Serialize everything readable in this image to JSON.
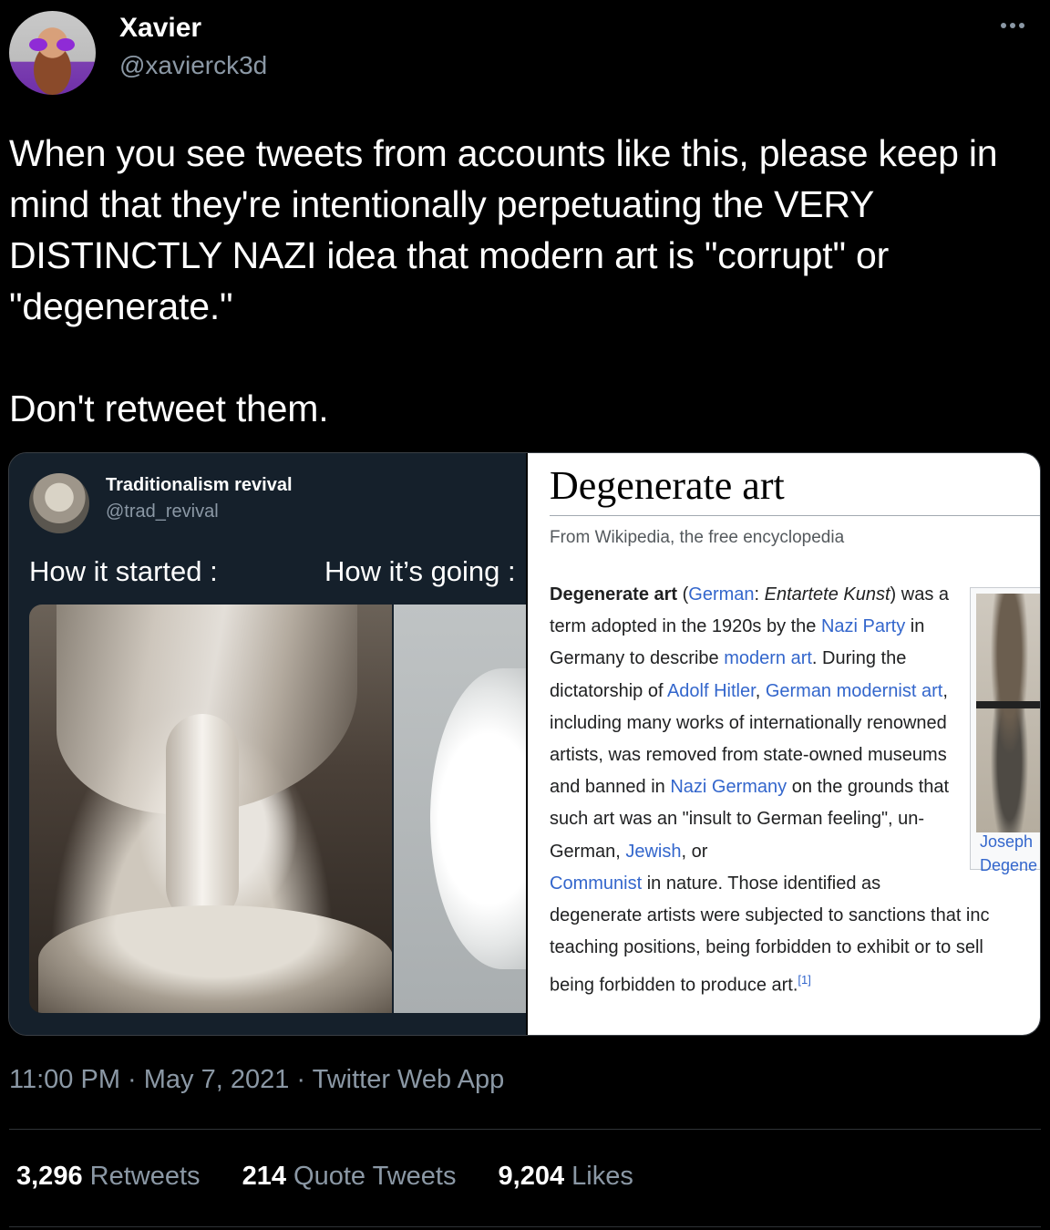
{
  "author": {
    "name": "Xavier",
    "handle": "@xavierck3d"
  },
  "tweet": {
    "text": "When you see tweets from accounts like this, please keep in mind that they're intentionally perpetuating the VERY DISTINCTLY NAZI idea that modern art is \"corrupt\" or \"degenerate.\"\n\nDon't retweet them.",
    "timestamp": "11:00 PM · May 7, 2021 · Twitter Web App"
  },
  "embedded": {
    "name": "Traditionalism revival",
    "handle": "@trad_revival",
    "caption_left": "How it started :",
    "caption_right": "How it’s going :"
  },
  "wiki": {
    "title": "Degenerate art",
    "from": "From Wikipedia, the free encyclopedia",
    "term": "Degenerate art",
    "german_label": "German",
    "german_term": "Entartete Kunst",
    "t1": "was a term adopted in the 1920s by the",
    "link_nazi_party": "Nazi Party",
    "t2": " in Germany to describe ",
    "link_modern_art": "modern art",
    "t3": ". During the dictatorship of ",
    "link_hitler": "Adolf Hitler",
    "link_german_modernist": "German modernist art",
    "t4": ", including many works of internationally renowned artists, was removed from state-owned museums and banned in ",
    "link_nazi_germany": "Nazi Germany",
    "t5": " on the grounds that such art was an \"insult to German feeling\", un-German, ",
    "link_jewish": "Jewish",
    "t6": ", or ",
    "link_communist": "Communist",
    "t7": " in nature. Those identified as",
    "t8": "degenerate artists were subjected to sanctions that inc",
    "t9": "teaching positions, being forbidden to exhibit or to sell",
    "t10": "being forbidden to produce art.",
    "cite": "[1]",
    "thumb_caption_1": "Joseph",
    "thumb_caption_2": "Degene"
  },
  "stats": {
    "retweets_count": "3,296",
    "retweets_label": "Retweets",
    "quotes_count": "214",
    "quotes_label": "Quote Tweets",
    "likes_count": "9,204",
    "likes_label": "Likes"
  },
  "colors": {
    "background": "#000000",
    "secondary_text": "#8b98a5",
    "link": "#3366cc"
  }
}
